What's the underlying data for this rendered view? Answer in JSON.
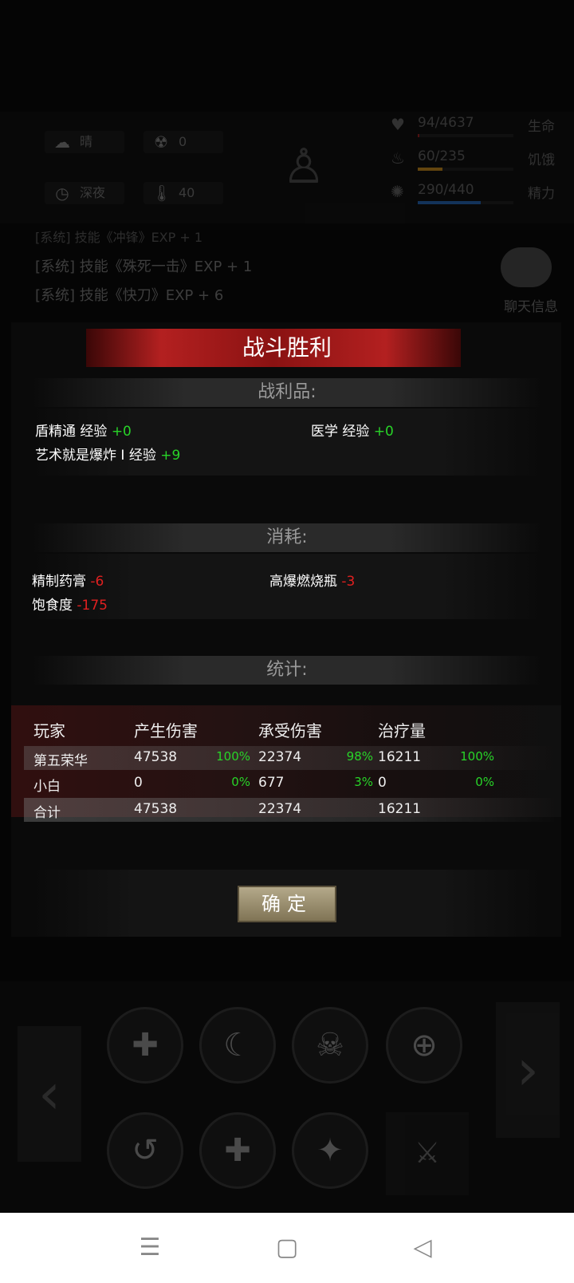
{
  "hud": {
    "weather": "晴",
    "radiation": "0",
    "time_of_day": "深夜",
    "temperature": "40",
    "stats": [
      {
        "value": "94/4637",
        "name": "生命",
        "fill": 0.02,
        "color": "#8a1a1a"
      },
      {
        "value": "60/235",
        "name": "饥饿",
        "fill": 0.26,
        "color": "#b07a18"
      },
      {
        "value": "290/440",
        "name": "精力",
        "fill": 0.66,
        "color": "#1f5aa0"
      }
    ]
  },
  "log": {
    "line1": "[系统] 技能《冲锋》EXP + 1",
    "line2": "[系统] 技能《殊死一击》EXP + 1",
    "line3": "[系统] 技能《快刀》EXP + 6"
  },
  "chat": {
    "label": "聊天信息"
  },
  "dialog": {
    "title": "战斗胜利",
    "loot": {
      "header": "战利品:",
      "items": [
        {
          "name": "盾精通 经验",
          "delta": "+0"
        },
        {
          "name": "医学 经验",
          "delta": "+0"
        },
        {
          "name": "艺术就是爆炸 I  经验",
          "delta": "+9"
        }
      ]
    },
    "consume": {
      "header": "消耗:",
      "items": [
        {
          "name": "精制药膏",
          "delta": "-6"
        },
        {
          "name": "高爆燃烧瓶",
          "delta": "-3"
        },
        {
          "name": "饱食度",
          "delta": "-175"
        }
      ]
    },
    "stats": {
      "header": "统计:",
      "columns": [
        "玩家",
        "产生伤害",
        "承受伤害",
        "治疗量"
      ],
      "rows": [
        {
          "player": "第五荣华",
          "dmg": "47538",
          "dmg_pct": "100%",
          "taken": "22374",
          "taken_pct": "98%",
          "heal": "16211",
          "heal_pct": "100%"
        },
        {
          "player": "小白",
          "dmg": "0",
          "dmg_pct": "0%",
          "taken": "677",
          "taken_pct": "3%",
          "heal": "0",
          "heal_pct": "0%"
        }
      ],
      "total": {
        "player": "合计",
        "dmg": "47538",
        "taken": "22374",
        "heal": "16211"
      }
    },
    "confirm_label": "确定"
  },
  "navbar": {
    "menu_icon": "menu-icon",
    "home_icon": "home-icon",
    "back_icon": "back-icon"
  }
}
